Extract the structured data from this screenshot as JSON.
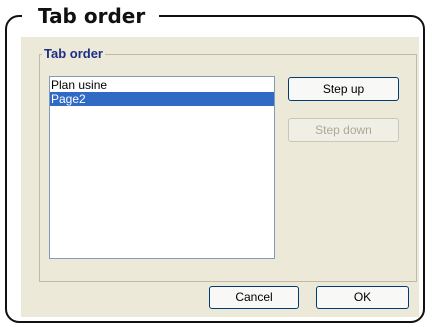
{
  "window": {
    "title": "Tab order"
  },
  "group": {
    "legend": "Tab order"
  },
  "tab_list": {
    "items": [
      {
        "label": "Plan usine",
        "selected": false
      },
      {
        "label": "Page2",
        "selected": true
      }
    ]
  },
  "buttons": {
    "step_up": {
      "label": "Step up",
      "enabled": true
    },
    "step_down": {
      "label": "Step down",
      "enabled": false
    },
    "cancel": {
      "label": "Cancel",
      "enabled": true
    },
    "ok": {
      "label": "OK",
      "enabled": true
    }
  },
  "colors": {
    "dialog_background": "#ece9d8",
    "legend_text": "#1c2f85",
    "selection_background": "#316ac5",
    "selection_text": "#ffffff",
    "disabled_text": "#aca899"
  }
}
